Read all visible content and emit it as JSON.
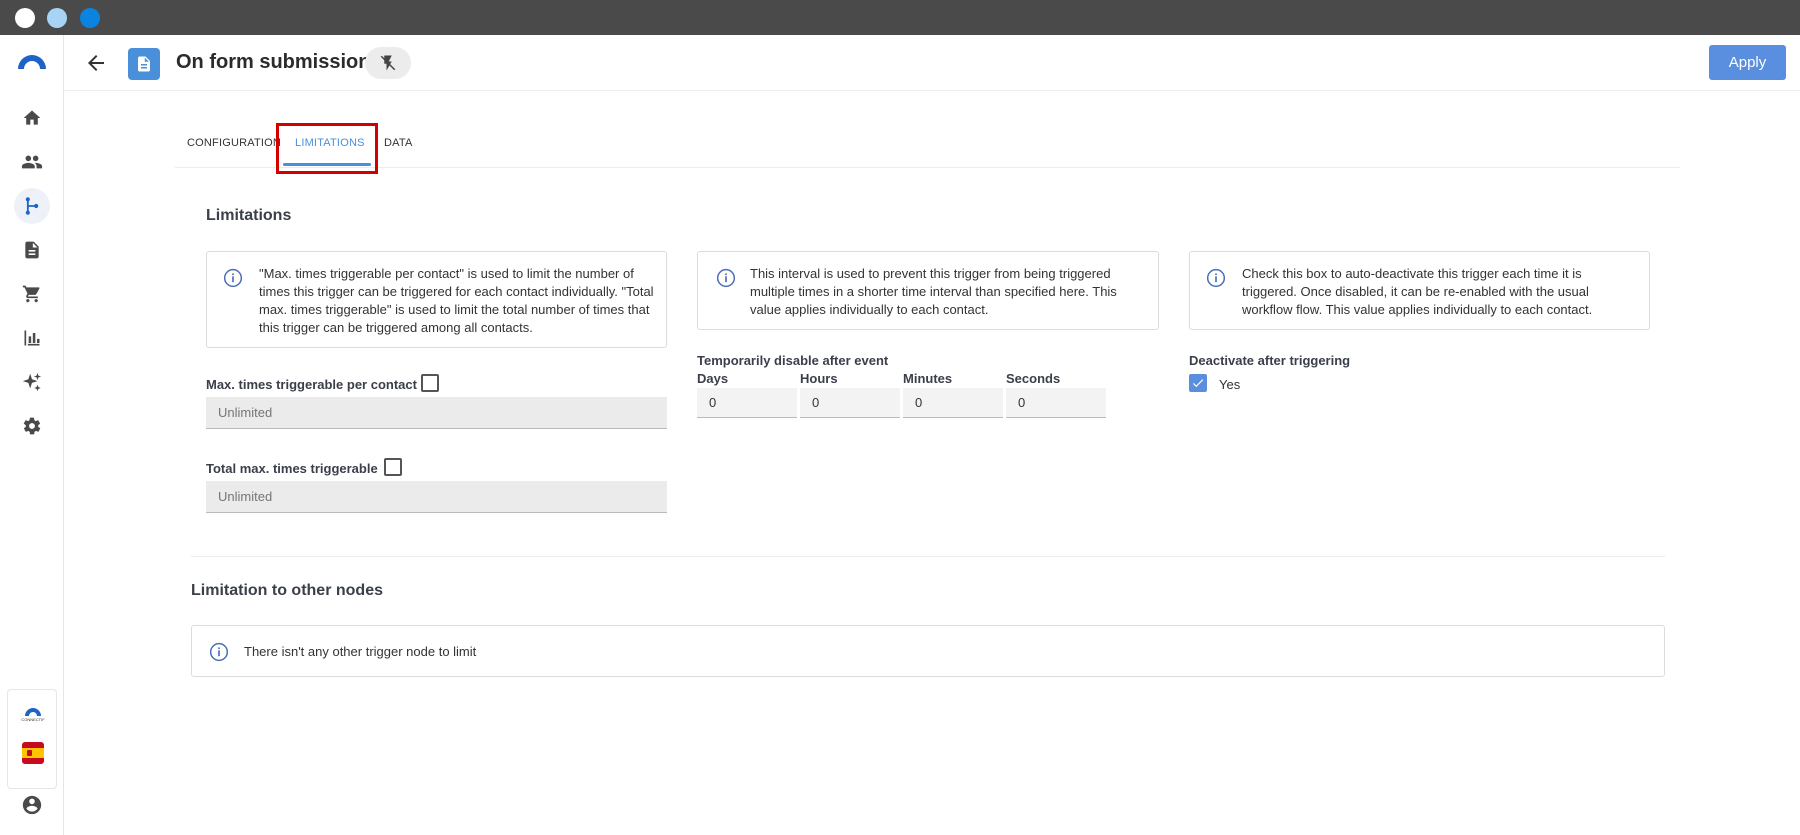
{
  "window": {
    "dot_colors": [
      "#ffffff",
      "#a7d4f5",
      "#0a84e0"
    ]
  },
  "header": {
    "title": "On form submission",
    "apply_label": "Apply"
  },
  "sidebar": {
    "items": [
      {
        "icon": "home-icon"
      },
      {
        "icon": "contacts-icon"
      },
      {
        "icon": "workflow-icon",
        "active": true
      },
      {
        "icon": "document-icon"
      },
      {
        "icon": "cart-icon"
      },
      {
        "icon": "analytics-icon"
      },
      {
        "icon": "sparkle-icon"
      },
      {
        "icon": "gear-icon"
      }
    ],
    "brand_small": "CONNECTIF"
  },
  "tabs": [
    {
      "label": "CONFIGURATION"
    },
    {
      "label": "LIMITATIONS",
      "active": true
    },
    {
      "label": "DATA"
    }
  ],
  "limitations": {
    "title": "Limitations",
    "info1": "\"Max. times triggerable per contact\" is used to limit the number of times this trigger can be triggered for each contact individually. \"Total max. times triggerable\" is used to limit the total number of times that this trigger can be triggered among all contacts.",
    "info2": "This interval is used to prevent this trigger from being triggered multiple times in a shorter time interval than specified here. This value applies individually to each contact.",
    "info3": "Check this box to auto-deactivate this trigger each time it is triggered. Once disabled, it can be re-enabled with the usual workflow flow. This value applies individually to each contact.",
    "max_per_contact_label": "Max. times triggerable per contact",
    "max_per_contact_placeholder": "Unlimited",
    "total_max_label": "Total max. times triggerable",
    "total_max_placeholder": "Unlimited",
    "disable_title": "Temporarily disable after event",
    "days_label": "Days",
    "hours_label": "Hours",
    "minutes_label": "Minutes",
    "seconds_label": "Seconds",
    "days": "0",
    "hours": "0",
    "minutes": "0",
    "seconds": "0",
    "deactivate_label": "Deactivate after triggering",
    "deactivate_option": "Yes"
  },
  "other_nodes": {
    "title": "Limitation to other nodes",
    "message": "There isn't any other trigger node to limit"
  },
  "accent_color": "#5a8fe0"
}
